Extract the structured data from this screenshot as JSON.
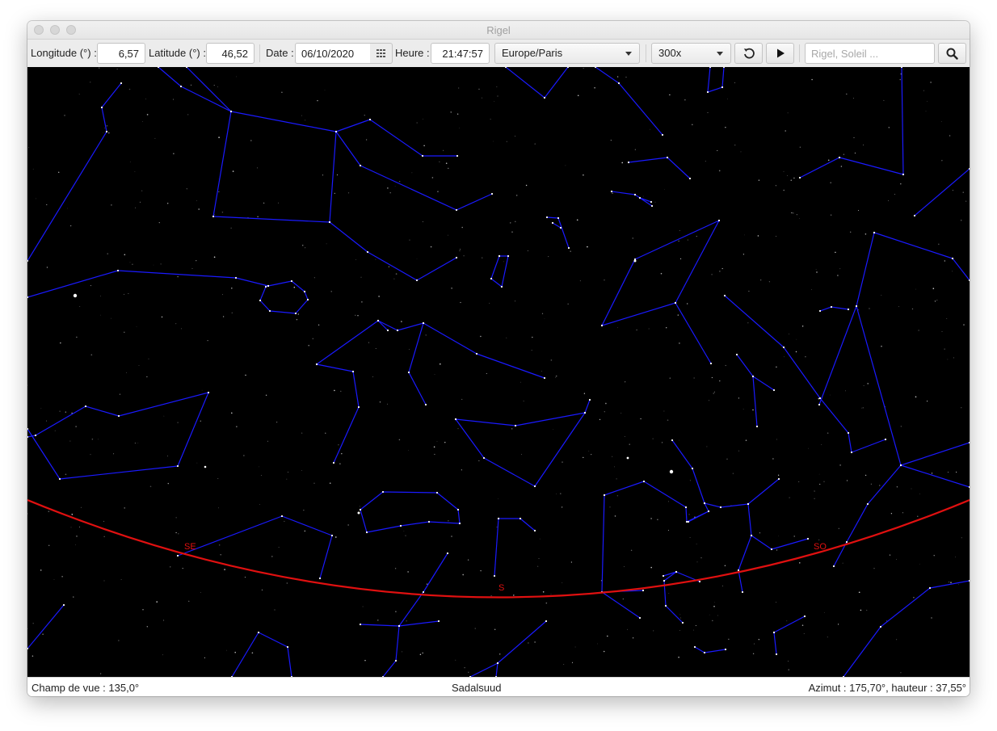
{
  "window": {
    "title": "Rigel"
  },
  "toolbar": {
    "longitude_label": "Longitude (°) :",
    "longitude_value": "6,57",
    "latitude_label": "Latitude (°) :",
    "latitude_value": "46,52",
    "date_label": "Date :",
    "date_value": "06/10/2020",
    "time_label": "Heure :",
    "time_value": "21:47:57",
    "timezone_selected": "Europe/Paris",
    "speed_selected": "300x",
    "search_placeholder": "Rigel, Soleil ..."
  },
  "sky": {
    "background_color": "#000000",
    "constellation_color": "#1a1aff",
    "horizon_color": "#e01010",
    "horizon_labels": [
      "SE",
      "S",
      "SO"
    ]
  },
  "status": {
    "fov": "Champ de vue : 135,0°",
    "object_name": "Sadalsuud",
    "position": "Azimut : 175,70°, hauteur : 37,55°"
  }
}
